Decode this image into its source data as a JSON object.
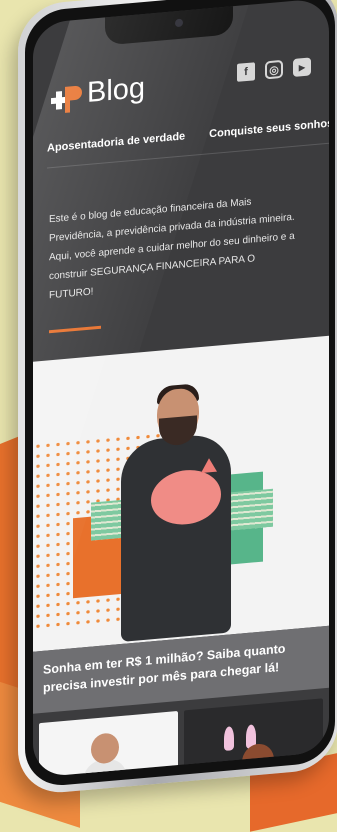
{
  "app": {
    "brand": "Blog",
    "social_icons": [
      "facebook-icon",
      "instagram-icon",
      "youtube-icon"
    ]
  },
  "nav": {
    "tabs": [
      {
        "label": "Aposentadoria de verdade"
      },
      {
        "label": "Conquiste seus sonhos"
      }
    ]
  },
  "intro": {
    "text": "Este é o blog de educação financeira da Mais Previdência, a previdência privada da indústria mineira. Aqui, você aprende a cuidar melhor do seu dinheiro e a construir SEGURANÇA FINANCEIRA PARA O FUTURO!"
  },
  "featured_post": {
    "title": "Sonha em ter R$ 1 milhão? Saiba quanto precisa investir por mês para chegar lá!"
  },
  "colors": {
    "accent": "#e8712c",
    "screen_bg": "#3c3c3e",
    "caption_bg": "#6f6f72",
    "page_bg": "#e9e5ae"
  }
}
